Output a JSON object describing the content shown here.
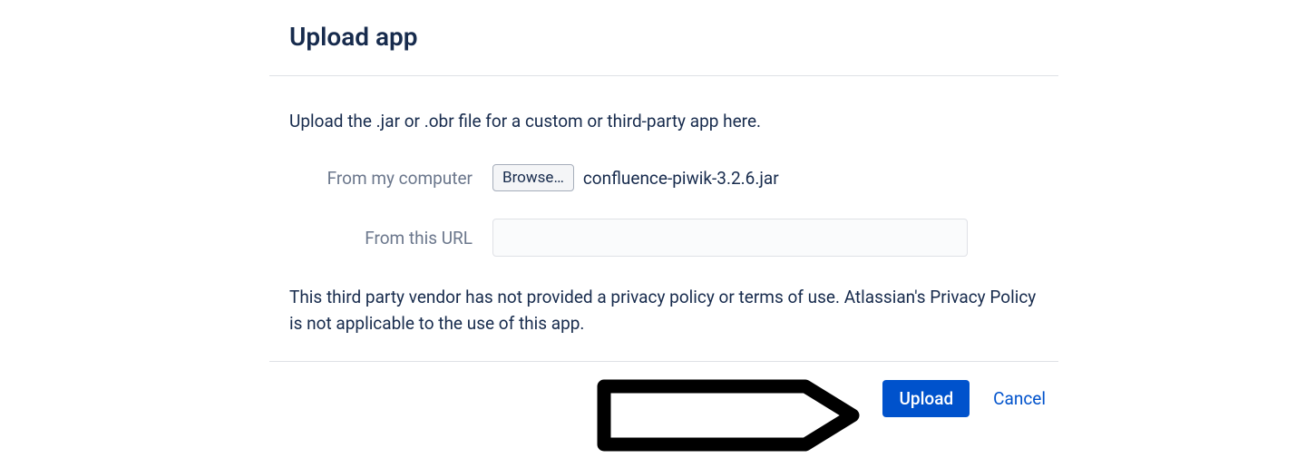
{
  "dialog": {
    "title": "Upload app",
    "instruction": "Upload the .jar or .obr file for a custom or third-party app here.",
    "labels": {
      "from_computer": "From my computer",
      "from_url": "From this URL"
    },
    "browse_button": "Browse…",
    "selected_filename": "confluence-piwik-3.2.6.jar",
    "url_value": "",
    "privacy_note": "This third party vendor has not provided a privacy policy or terms of use. Atlassian's Privacy Policy is not applicable to the use of this app.",
    "buttons": {
      "upload": "Upload",
      "cancel": "Cancel"
    }
  }
}
